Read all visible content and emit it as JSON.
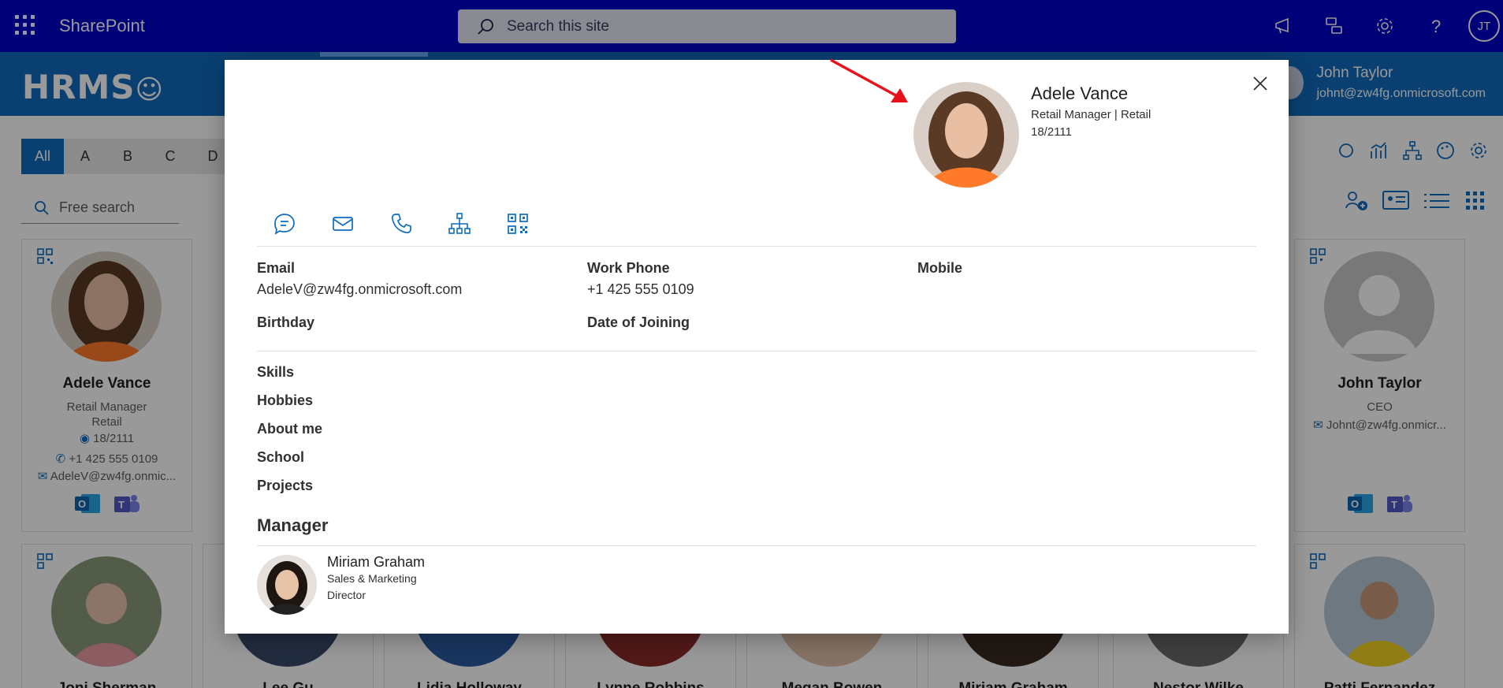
{
  "suitebar": {
    "app_name": "SharePoint",
    "search_placeholder": "Search this site",
    "user_initials": "JT",
    "icons": [
      "megaphone-icon",
      "feedback-icon",
      "gear-icon",
      "help-icon"
    ]
  },
  "header": {
    "logo": "HRMS",
    "user_name": "John Taylor",
    "user_email": "johnt@zw4fg.onmicrosoft.com"
  },
  "filters": {
    "letters": [
      "All",
      "A",
      "B",
      "C",
      "D"
    ],
    "active_letter": "All",
    "free_search_placeholder": "Free search"
  },
  "cards": [
    {
      "name": "Adele Vance",
      "title": "Retail Manager",
      "department": "Retail",
      "location": "18/2111",
      "phone": "+1 425 555 0109",
      "email": "AdeleV@zw4fg.onmic..."
    },
    {
      "name": "John Taylor",
      "title": "CEO",
      "email": "Johnt@zw4fg.onmicr..."
    }
  ],
  "bottom_row_names": [
    "Joni Sherman",
    "Lee Gu",
    "Lidia Holloway",
    "Lynne Robbins",
    "Megan Bowen",
    "Miriam Graham",
    "Nestor Wilke",
    "Patti Fernandez"
  ],
  "dialog": {
    "name": "Adele Vance",
    "title_line": "Retail Manager | Retail",
    "location": "18/2111",
    "actions": [
      "chat-icon",
      "mail-icon",
      "phone-icon",
      "org-chart-icon",
      "qr-code-icon"
    ],
    "fields": {
      "email_label": "Email",
      "email_value": "AdeleV@zw4fg.onmicrosoft.com",
      "work_phone_label": "Work Phone",
      "work_phone_value": "+1 425 555 0109",
      "mobile_label": "Mobile",
      "birthday_label": "Birthday",
      "doj_label": "Date of Joining"
    },
    "sections": [
      "Skills",
      "Hobbies",
      "About me",
      "School",
      "Projects"
    ],
    "manager": {
      "heading": "Manager",
      "name": "Miriam Graham",
      "dept": "Sales & Marketing",
      "title": "Director"
    }
  },
  "colors": {
    "suitebar": "#0000c8",
    "hrms": "#0f6cbd",
    "accent": "#0f6cbd",
    "arrow": "#e8101a"
  }
}
